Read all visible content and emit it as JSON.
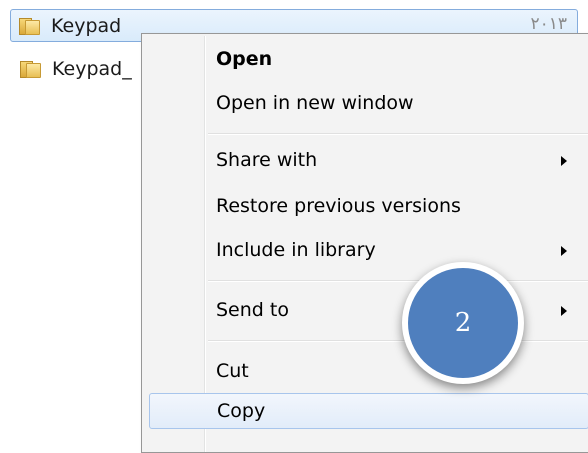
{
  "files": [
    {
      "name": "Keypad",
      "date": "٢٠١٣",
      "selected": true
    },
    {
      "name": "Keypad_",
      "selected": false
    }
  ],
  "context_menu": {
    "items": [
      {
        "label": "Open",
        "bold": true
      },
      {
        "label": "Open in new window"
      },
      {
        "label": "Share with",
        "submenu": true
      },
      {
        "label": "Restore previous versions"
      },
      {
        "label": "Include in library",
        "submenu": true
      },
      {
        "label": "Send to",
        "submenu": true
      },
      {
        "label": "Cut"
      },
      {
        "label": "Copy",
        "highlighted": true
      }
    ]
  },
  "callout": {
    "number": "2",
    "color": "#4f7fbe"
  },
  "icons": {
    "folder": "folder-icon",
    "submenu": "submenu-arrow-icon"
  }
}
